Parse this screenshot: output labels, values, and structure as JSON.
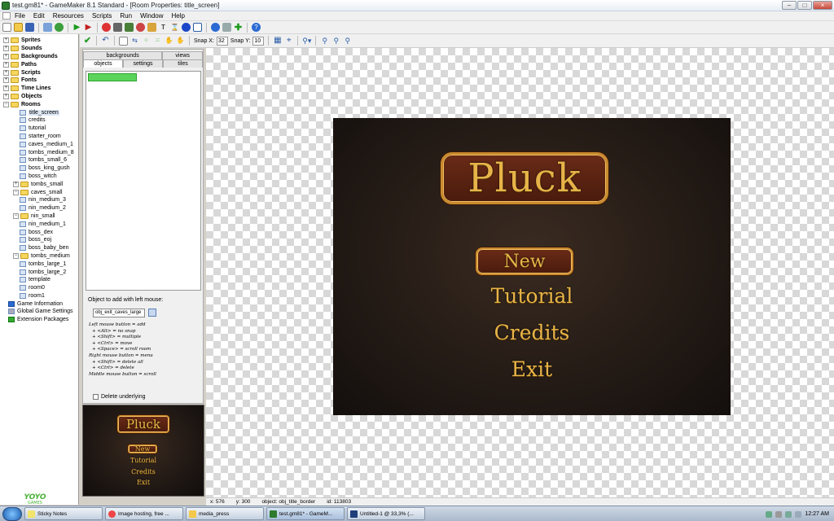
{
  "window": {
    "title": "test.gm81* - GameMaker 8.1 Standard - [Room Properties: title_screen]",
    "controls": [
      "–",
      "□",
      "×"
    ]
  },
  "menu": [
    "File",
    "Edit",
    "Resources",
    "Scripts",
    "Run",
    "Window",
    "Help"
  ],
  "tree": {
    "folders": [
      "Sprites",
      "Sounds",
      "Backgrounds",
      "Paths",
      "Scripts",
      "Fonts",
      "Time Lines",
      "Objects",
      "Rooms"
    ],
    "rooms": [
      "title_screen",
      "credits",
      "tutorial",
      "starter_room",
      "caves_medium_1",
      "tombs_medium_8",
      "tombs_small_6",
      "boss_king_gush",
      "boss_witch"
    ],
    "sub1_folder": "tombs_small",
    "sub2_folder": "caves_small",
    "sub2_items": [
      "nin_medium_3",
      "nin_medium_2"
    ],
    "sub3_folder": "nin_small",
    "sub3_items": [
      "nin_medium_1",
      "boss_dex",
      "boss_eoj",
      "boss_baby_ben"
    ],
    "sub4_folder": "tombs_medium",
    "sub4_items": [
      "tombs_large_1",
      "tombs_large_2",
      "template",
      "room0",
      "room1"
    ],
    "extras": [
      "Game Information",
      "Global Game Settings",
      "Extension Packages"
    ]
  },
  "logo": "YOYO GAMES",
  "room_toolbar": {
    "snap_x_label": "Snap X:",
    "snap_x": "32",
    "snap_y_label": "Snap Y:",
    "snap_y": "10"
  },
  "tabs": {
    "top": [
      "backgrounds",
      "views"
    ],
    "bottom": [
      "objects",
      "settings",
      "tiles"
    ]
  },
  "object_panel": {
    "add_label": "Object to add with left mouse:",
    "object_value": "obj_exit_caves_large",
    "help": [
      "Left mouse button = add",
      "  + <Alt> = no snap",
      "  + <Shift> = multiple",
      "  + <Ctrl> = move",
      "  + <Space> = scroll room",
      "Right mouse button = menu",
      "  + <Shift> = delete all",
      "  + <Ctrl> = delete",
      "Middle mouse button = scroll"
    ],
    "delete_underlying": "Delete underlying"
  },
  "room": {
    "title": "Pluck",
    "menu": [
      "New",
      "Tutorial",
      "Credits",
      "Exit"
    ]
  },
  "status": {
    "x": "x: 576",
    "y": "y: 300",
    "object": "object: obj_title_border",
    "id": "id: 113803"
  },
  "taskbar": {
    "items": [
      "Sticky Notes",
      "Image hosting, free ...",
      "media_press",
      "test.gm81* - GameM...",
      "Untitled-1 @ 33,3% (..."
    ],
    "clock": "12:27 AM"
  },
  "colors": {
    "gold": "#e7b449",
    "room_bg": "#231a15",
    "plaque": "#5a2210"
  }
}
